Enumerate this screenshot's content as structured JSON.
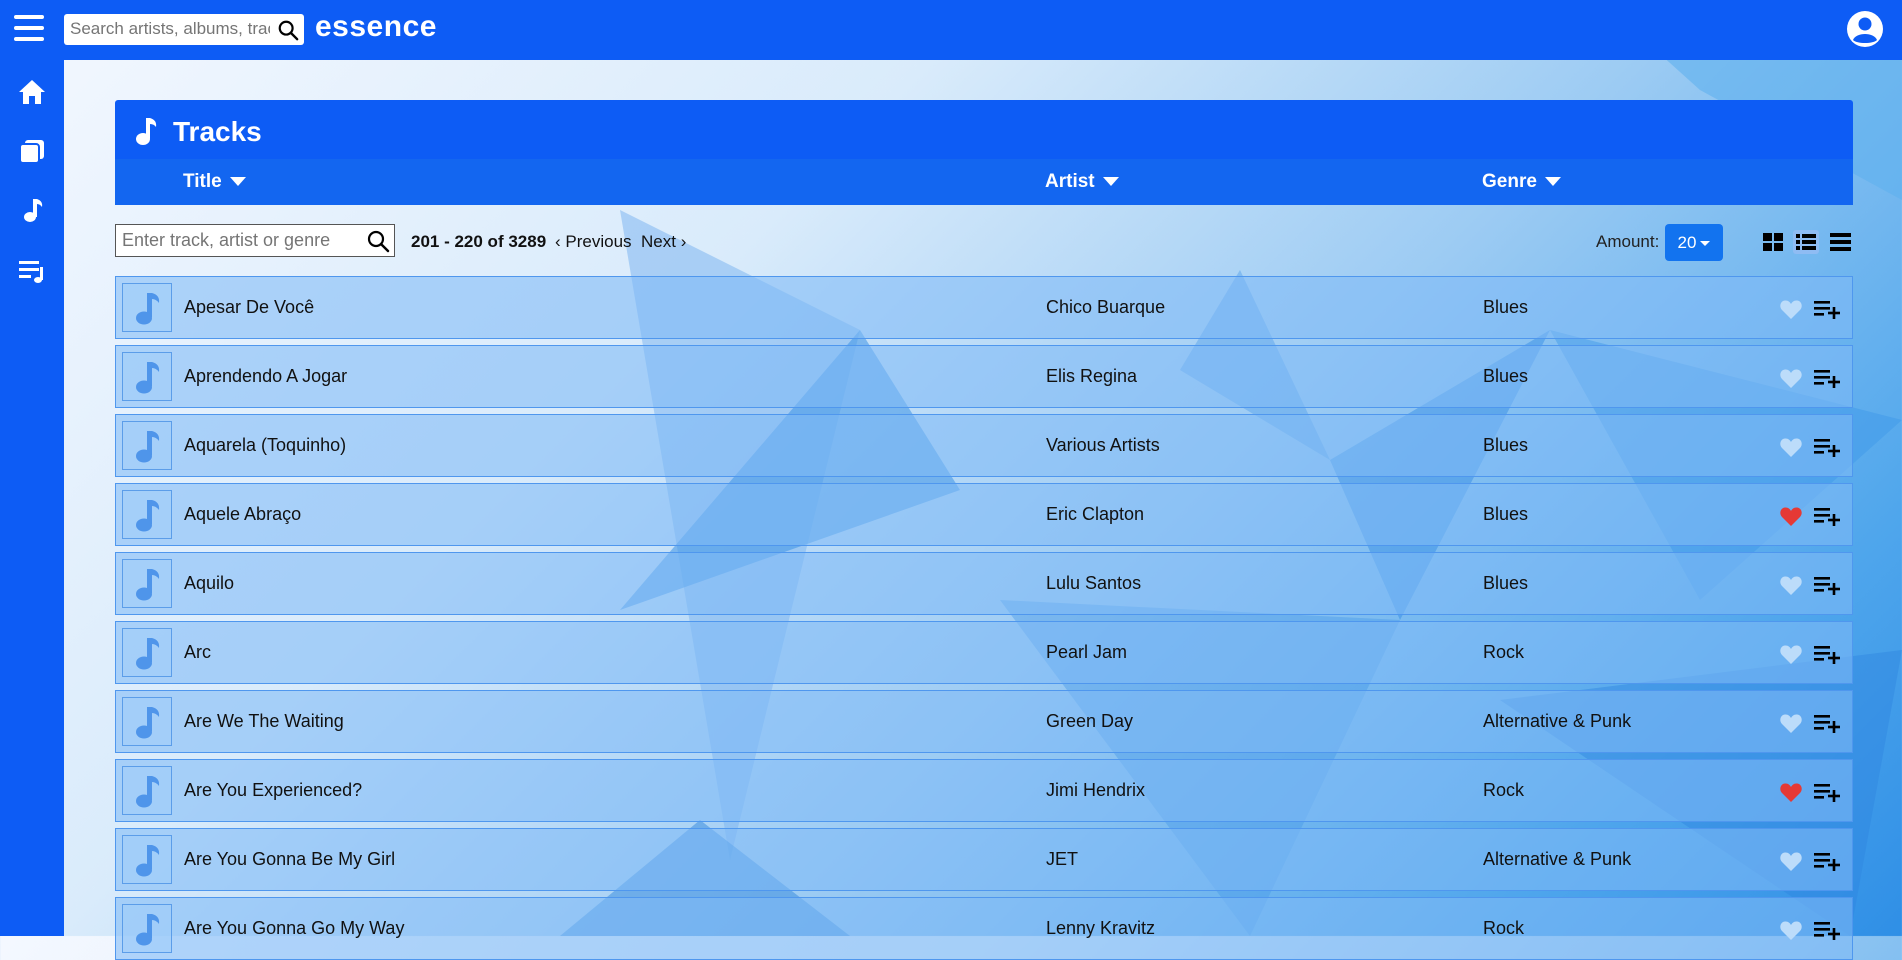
{
  "app": {
    "brand": "essence"
  },
  "search": {
    "placeholder": "Search artists, albums, tracks"
  },
  "sidebar": {
    "items": [
      {
        "icon": "home-icon"
      },
      {
        "icon": "albums-icon"
      },
      {
        "icon": "music-note-icon"
      },
      {
        "icon": "playlist-icon"
      }
    ]
  },
  "page": {
    "title": "Tracks",
    "columns": {
      "title": "Title",
      "artist": "Artist",
      "genre": "Genre"
    }
  },
  "toolbar": {
    "filter_placeholder": "Enter track, artist or genre",
    "range": "201 - 220 of 3289",
    "previous": "Previous",
    "next": "Next",
    "amount_label": "Amount:",
    "amount_value": "20",
    "views": [
      "grid-view-icon",
      "list-view-icon",
      "compact-list-icon"
    ],
    "active_view": "list-view-icon"
  },
  "colors": {
    "accent": "#0d5cf5",
    "liked": "#e53935",
    "not_liked": "#bcdcfa"
  },
  "tracks": [
    {
      "title": "Apesar De Você",
      "artist": "Chico Buarque",
      "genre": "Blues",
      "liked": false
    },
    {
      "title": "Aprendendo A Jogar",
      "artist": "Elis Regina",
      "genre": "Blues",
      "liked": false
    },
    {
      "title": "Aquarela (Toquinho)",
      "artist": "Various Artists",
      "genre": "Blues",
      "liked": false
    },
    {
      "title": "Aquele Abraço",
      "artist": "Eric Clapton",
      "genre": "Blues",
      "liked": true
    },
    {
      "title": "Aquilo",
      "artist": "Lulu Santos",
      "genre": "Blues",
      "liked": false
    },
    {
      "title": "Arc",
      "artist": "Pearl Jam",
      "genre": "Rock",
      "liked": false
    },
    {
      "title": "Are We The Waiting",
      "artist": "Green Day",
      "genre": "Alternative & Punk",
      "liked": false
    },
    {
      "title": "Are You Experienced?",
      "artist": "Jimi Hendrix",
      "genre": "Rock",
      "liked": true
    },
    {
      "title": "Are You Gonna Be My Girl",
      "artist": "JET",
      "genre": "Alternative & Punk",
      "liked": false
    },
    {
      "title": "Are You Gonna Go My Way",
      "artist": "Lenny Kravitz",
      "genre": "Rock",
      "liked": false
    }
  ]
}
